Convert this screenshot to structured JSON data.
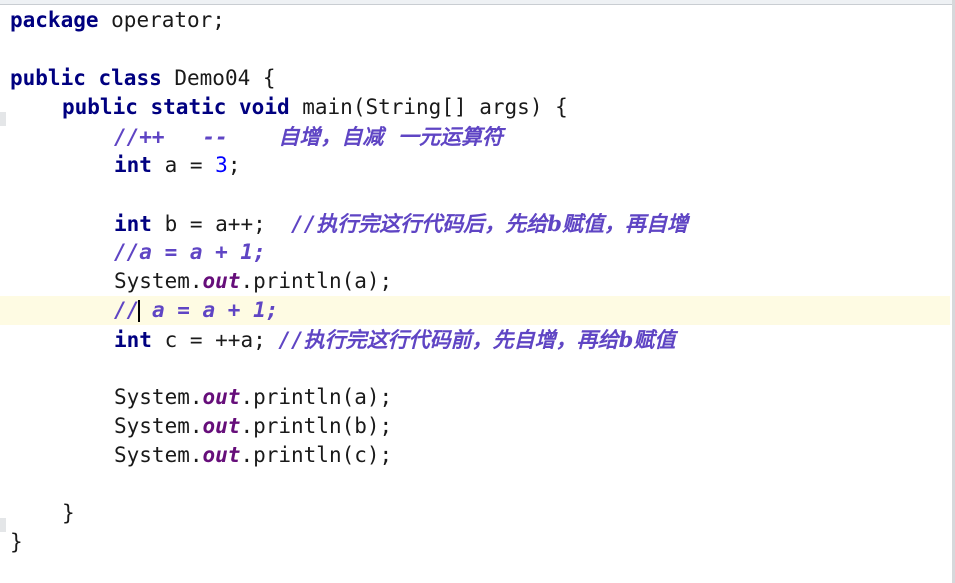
{
  "editor": {
    "lines": {
      "l1": {
        "kw": "package",
        "rest": " operator;"
      },
      "l3": {
        "kw1": "public",
        "kw2": "class",
        "rest": " Demo04 {"
      },
      "l4": {
        "kw1": "public",
        "kw2": "static",
        "kw3": "void",
        "rest": " main(String[] args) {"
      },
      "l5": {
        "comment_code": "//++   --    ",
        "comment_text": "自增，自减  一元运算符"
      },
      "l6": {
        "kw": "int",
        "mid": " a = ",
        "num": "3",
        "end": ";"
      },
      "l8": {
        "kw": "int",
        "mid": " b = a++;  ",
        "comment_code": "//",
        "comment_text": "执行完这行代码后，先给b赋值，再自增"
      },
      "l9": {
        "comment_code": "//a = a + 1;"
      },
      "l10": {
        "pre": "System.",
        "field": "out",
        "post": ".println(a);"
      },
      "l11": {
        "comment_pre": "//",
        "comment_post": " a = a + 1;"
      },
      "l12": {
        "kw": "int",
        "mid": " c = ++a; ",
        "comment_code": "//",
        "comment_text": "执行完这行代码前，先自增，再给b赋值"
      },
      "l14": {
        "pre": "System.",
        "field": "out",
        "post": ".println(a);"
      },
      "l15": {
        "pre": "System.",
        "field": "out",
        "post": ".println(b);"
      },
      "l16": {
        "pre": "System.",
        "field": "out",
        "post": ".println(c);"
      },
      "l18": {
        "text": "}"
      },
      "l19": {
        "text": "}"
      }
    }
  },
  "colors": {
    "keyword": "#000080",
    "number": "#0000ff",
    "static_field": "#660e7a",
    "comment": "#5f45c4",
    "current_line": "#fefbe3",
    "background": "#ffffff"
  }
}
